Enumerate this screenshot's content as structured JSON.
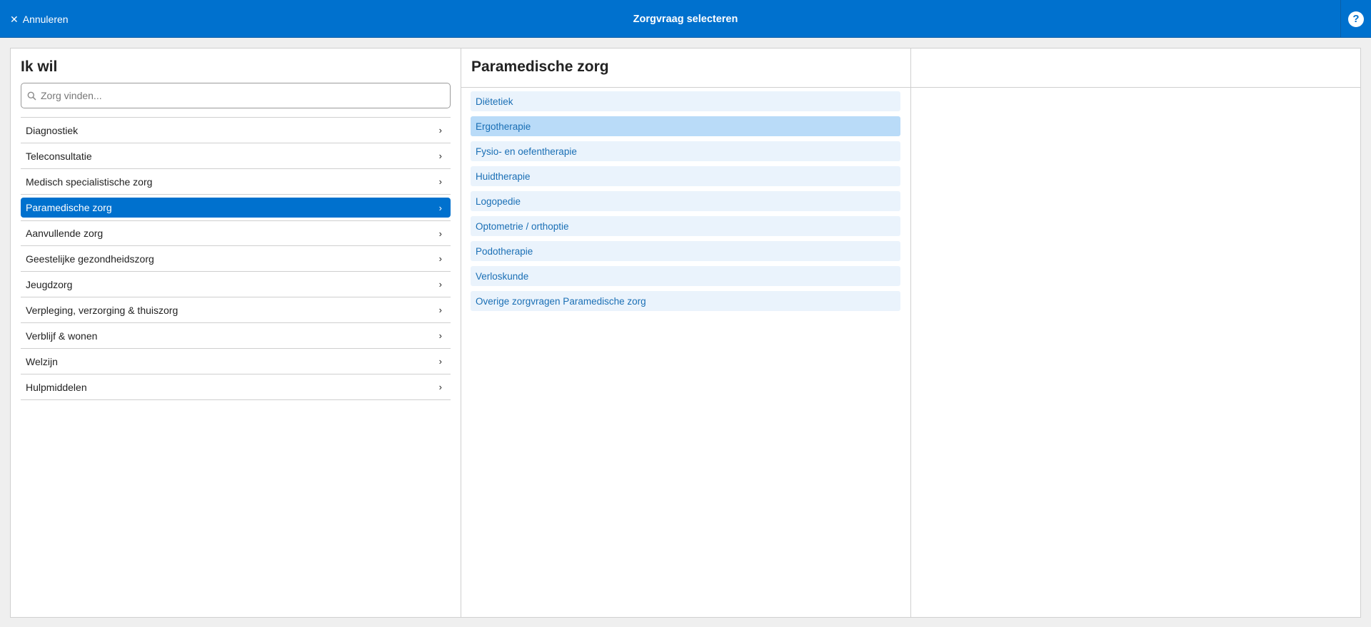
{
  "topbar": {
    "cancel_label": "Annuleren",
    "cancel_icon": "close-icon",
    "title": "Zorgvraag selecteren",
    "help_glyph": "?",
    "background_color": "#0071ce"
  },
  "left": {
    "title": "Ik wil",
    "search": {
      "placeholder": "Zorg vinden...",
      "value": ""
    },
    "items": [
      {
        "label": "Diagnostiek"
      },
      {
        "label": "Teleconsultatie"
      },
      {
        "label": "Medisch specialistische zorg"
      },
      {
        "label": "Paramedische zorg",
        "selected": true
      },
      {
        "label": "Aanvullende zorg"
      },
      {
        "label": "Geestelijke gezondheidszorg"
      },
      {
        "label": "Jeugdzorg"
      },
      {
        "label": "Verpleging, verzorging & thuiszorg"
      },
      {
        "label": "Verblijf & wonen"
      },
      {
        "label": "Welzijn"
      },
      {
        "label": "Hulpmiddelen"
      }
    ]
  },
  "middle": {
    "title": "Paramedische zorg",
    "items": [
      {
        "label": "Diëtetiek"
      },
      {
        "label": "Ergotherapie",
        "hovered": true
      },
      {
        "label": "Fysio- en oefentherapie"
      },
      {
        "label": "Huidtherapie"
      },
      {
        "label": "Logopedie"
      },
      {
        "label": "Optometrie / orthoptie"
      },
      {
        "label": "Podotherapie"
      },
      {
        "label": "Verloskunde"
      },
      {
        "label": "Overige zorgvragen Paramedische zorg"
      }
    ]
  },
  "right": {
    "title": ""
  },
  "colors": {
    "accent": "#0071ce",
    "sub_item_bg": "#eaf3fc",
    "sub_item_hover_bg": "#b9dbf8",
    "sub_item_text": "#1a6fb5"
  }
}
